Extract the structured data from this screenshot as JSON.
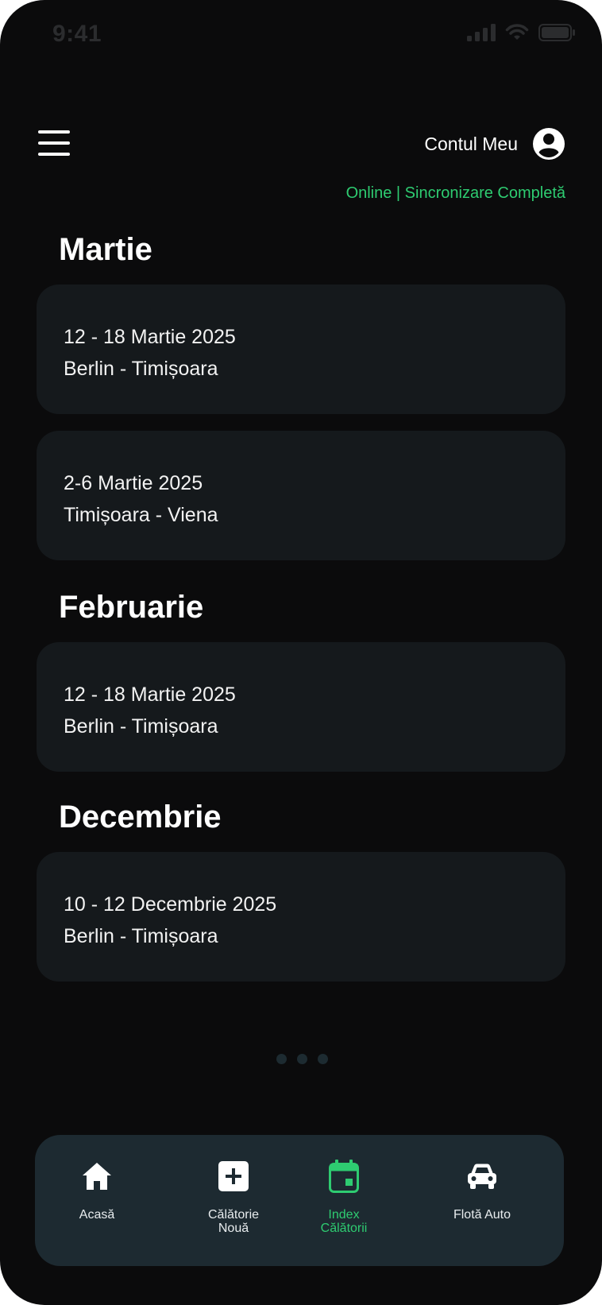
{
  "status_bar": {
    "time": "9:41"
  },
  "header": {
    "menu_icon": "hamburger-menu-icon",
    "account_label": "Contul Meu",
    "account_icon": "user-circle-icon",
    "sync_status": "Online | Sincronizare Completă",
    "sync_color": "#2ecc71"
  },
  "sections": [
    {
      "month": "Martie",
      "trips": [
        {
          "dates": "12 - 18 Martie 2025",
          "route": "Berlin - Timișoara"
        },
        {
          "dates": "2-6 Martie 2025",
          "route": "Timișoara - Viena"
        }
      ]
    },
    {
      "month": "Februarie",
      "trips": [
        {
          "dates": "12 - 18 Martie 2025",
          "route": "Berlin - Timișoara"
        }
      ]
    },
    {
      "month": "Decembrie",
      "trips": [
        {
          "dates": "10 - 12 Decembrie 2025",
          "route": "Berlin - Timișoara"
        }
      ]
    }
  ],
  "bottom_nav": {
    "items": [
      {
        "label": "Acasă",
        "icon": "home-icon",
        "active": false
      },
      {
        "label": "Călătorie\nNouă",
        "icon": "plus-square-icon",
        "active": false
      },
      {
        "label": "Index\nCălătorii",
        "icon": "calendar-icon",
        "active": true
      },
      {
        "label": "Flotă Auto",
        "icon": "car-icon",
        "active": false
      }
    ],
    "active_color": "#2ecc71"
  }
}
